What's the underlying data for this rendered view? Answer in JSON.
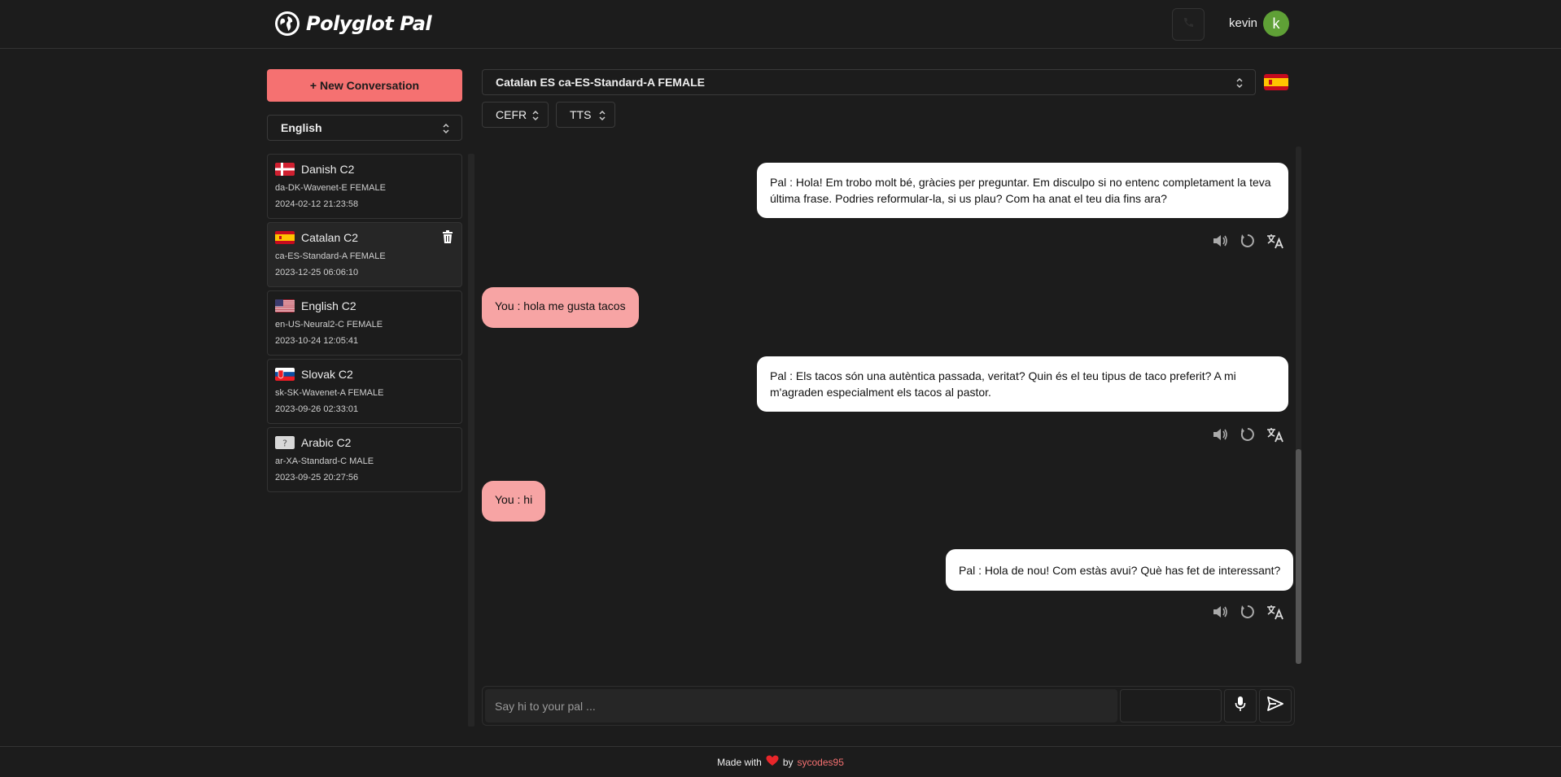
{
  "header": {
    "brand": "Polyglot Pal",
    "username": "kevin",
    "avatar_initial": "k",
    "avatar_color": "#5fa036"
  },
  "sidebar": {
    "new_conversation_label": "+ New Conversation",
    "language_select": "English",
    "conversations": [
      {
        "title": "Danish C2",
        "voice": "da-DK-Wavenet-E FEMALE",
        "date": "2024-02-12 21:23:58",
        "flag": "dk"
      },
      {
        "title": "Catalan C2",
        "voice": "ca-ES-Standard-A FEMALE",
        "date": "2023-12-25 06:06:10",
        "flag": "es",
        "active": true
      },
      {
        "title": "English C2",
        "voice": "en-US-Neural2-C FEMALE",
        "date": "2023-10-24 12:05:41",
        "flag": "us"
      },
      {
        "title": "Slovak C2",
        "voice": "sk-SK-Wavenet-A FEMALE",
        "date": "2023-09-26 02:33:01",
        "flag": "sk"
      },
      {
        "title": "Arabic C2",
        "voice": "ar-XA-Standard-C MALE",
        "date": "2023-09-25 20:27:56",
        "flag": "unknown"
      }
    ]
  },
  "controls": {
    "voice_select": "Catalan ES ca-ES-Standard-A FEMALE",
    "cefr_select": "CEFR",
    "tts_select": "TTS"
  },
  "messages": [
    {
      "from": "pal",
      "text": "Pal : Hola! Em trobo molt bé, gràcies per preguntar. Em disculpo si no entenc completament la teva última frase. Podries reformular-la, si us plau? Com ha anat el teu dia fins ara?"
    },
    {
      "from": "you",
      "text": "You : hola me gusta tacos"
    },
    {
      "from": "pal",
      "text": "Pal : Els tacos són una autèntica passada, veritat? Quin és el teu tipus de taco preferit? A mi m'agraden especialment els tacos al pastor."
    },
    {
      "from": "you",
      "text": "You : hi"
    },
    {
      "from": "pal",
      "text": "Pal : Hola de nou! Com estàs avui? Què has fet de interessant?"
    }
  ],
  "composer": {
    "placeholder": "Say hi to your pal ..."
  },
  "footer": {
    "made_with": "Made with",
    "by": "by",
    "author": "sycodes95"
  },
  "colors": {
    "accent": "#f57171",
    "user_bubble": "#f7a4a4",
    "background": "#1c1c1c"
  }
}
